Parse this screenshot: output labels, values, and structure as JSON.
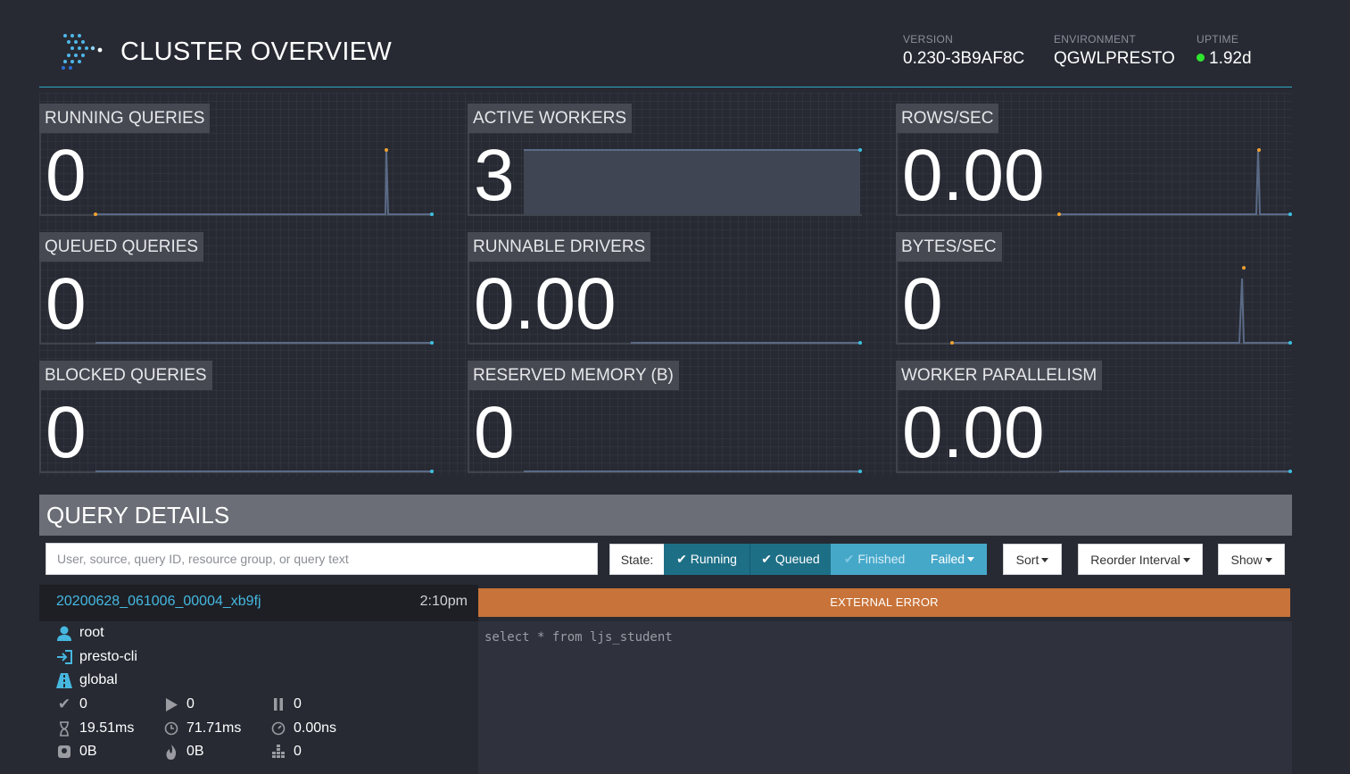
{
  "header": {
    "title": "CLUSTER OVERVIEW",
    "version_label": "VERSION",
    "version_value": "0.230-3B9AF8C",
    "environment_label": "ENVIRONMENT",
    "environment_value": "QGWLPRESTO",
    "uptime_label": "UPTIME",
    "uptime_value": "1.92d",
    "uptime_status_color": "#2ee62e"
  },
  "tiles": [
    {
      "label": "RUNNING QUERIES",
      "value": "0",
      "sparkline": "spike"
    },
    {
      "label": "ACTIVE WORKERS",
      "value": "3",
      "sparkline": "filled"
    },
    {
      "label": "ROWS/SEC",
      "value": "0.00",
      "sparkline": "spike"
    },
    {
      "label": "QUEUED QUERIES",
      "value": "0",
      "sparkline": "flat"
    },
    {
      "label": "RUNNABLE DRIVERS",
      "value": "0.00",
      "sparkline": "flat"
    },
    {
      "label": "BYTES/SEC",
      "value": "0",
      "sparkline": "spike"
    },
    {
      "label": "BLOCKED QUERIES",
      "value": "0",
      "sparkline": "flat"
    },
    {
      "label": "RESERVED MEMORY (B)",
      "value": "0",
      "sparkline": "flat"
    },
    {
      "label": "WORKER PARALLELISM",
      "value": "0.00",
      "sparkline": "flat"
    }
  ],
  "query_details": {
    "title": "QUERY DETAILS",
    "search_placeholder": "User, source, query ID, resource group, or query text",
    "state_label": "State:",
    "state_buttons": [
      "Running",
      "Queued",
      "Finished",
      "Failed"
    ],
    "sort_label": "Sort",
    "reorder_label": "Reorder Interval",
    "show_label": "Show"
  },
  "query": {
    "id": "20200628_061006_00004_xb9fj",
    "time": "2:10pm",
    "user": "root",
    "source": "presto-cli",
    "resource_group": "global",
    "completed_splits": "0",
    "running_splits": "0",
    "queued_splits": "0",
    "wall_time": "19.51ms",
    "elapsed_time": "71.71ms",
    "cpu_time": "0.00ns",
    "memory": "0B",
    "peak_memory": "0B",
    "cumulative": "0",
    "state": "EXTERNAL ERROR",
    "state_color": "#c87339",
    "sql": "select * from ljs_student"
  }
}
